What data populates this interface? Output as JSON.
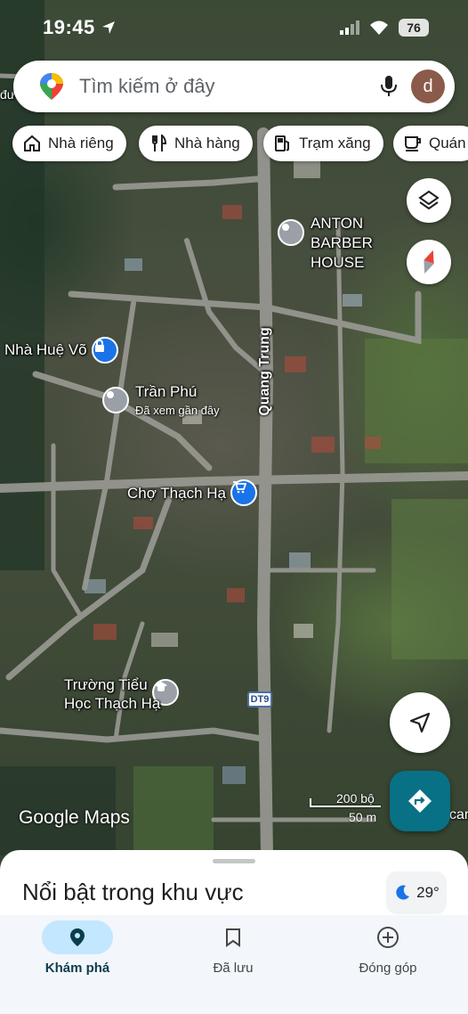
{
  "status_bar": {
    "time": "19:45",
    "battery": "76"
  },
  "search": {
    "placeholder": "Tìm kiếm ở đây",
    "avatar_letter": "d"
  },
  "chips": [
    {
      "label": "Nhà riêng",
      "icon": "home-icon"
    },
    {
      "label": "Nhà hàng",
      "icon": "restaurant-icon"
    },
    {
      "label": "Trạm xăng",
      "icon": "gas-station-icon"
    },
    {
      "label": "Quán",
      "icon": "cafe-icon"
    }
  ],
  "map": {
    "places": [
      {
        "name": "ANTON BARBER HOUSE",
        "icon": "place-pin-icon"
      },
      {
        "name": "Nhà Huệ Võ",
        "icon": "lock-pin-icon"
      },
      {
        "name": "Trần Phú",
        "note": "Đã xem gần đây",
        "icon": "place-pin-icon"
      },
      {
        "name": "Chợ Thạch Hạ",
        "icon": "shopping-cart-pin-icon"
      },
      {
        "name": "Trường Tiểu Học Thạch Hạ",
        "line1": "Trường Tiểu",
        "line2": "Học Thạch Hạ",
        "icon": "school-pin-icon"
      }
    ],
    "street_label": "Quang Trung",
    "road_badge": "DT9",
    "edge_label_left": "đư",
    "edge_label_right": "car",
    "scale": {
      "imperial": "200 bộ",
      "metric": "50 m"
    },
    "watermark": "Google Maps"
  },
  "sheet": {
    "title": "Nổi bật trong khu vực",
    "temperature": "29°"
  },
  "nav": [
    {
      "label": "Khám phá",
      "icon": "explore-pin-icon",
      "active": true
    },
    {
      "label": "Đã lưu",
      "icon": "bookmark-icon",
      "active": false
    },
    {
      "label": "Đóng góp",
      "icon": "add-circle-icon",
      "active": false
    }
  ],
  "colors": {
    "accent": "#0b57d0",
    "directions_fab": "#087185",
    "nav_active_pill": "#c2e7ff",
    "place_pin": "#9aa0a6",
    "poi_blue": "#1a73e8"
  }
}
